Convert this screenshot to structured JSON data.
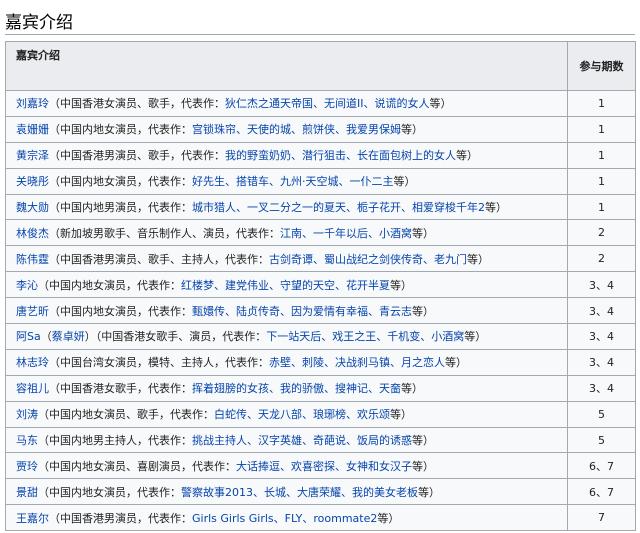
{
  "section": {
    "title": "嘉宾介绍"
  },
  "table": {
    "headers": {
      "guest": "嘉宾介绍",
      "episodes": "参与期数"
    },
    "rows": [
      {
        "name": "刘嘉玲",
        "desc": "（中国香港女演员、歌手，代表作：",
        "works": "狄仁杰之通天帝国、无间道II、说谎的女人",
        "tail": "等）",
        "episodes": "1"
      },
      {
        "name": "袁姗姗",
        "desc": "（中国内地女演员，代表作：",
        "works": "宫锁珠帘、天使的城、煎饼侠、我爱男保姆",
        "tail": "等）",
        "episodes": "1"
      },
      {
        "name": "黄宗泽",
        "desc": "（中国香港男演员、歌手，代表作：",
        "works": "我的野蛮奶奶、潜行狙击、长在面包树上的女人",
        "tail": "等）",
        "episodes": "1"
      },
      {
        "name": "关晓彤",
        "desc": "（中国内地女演员，代表作：",
        "works": "好先生、搭错车、九州·天空城、一仆二主",
        "tail": "等）",
        "episodes": "1"
      },
      {
        "name": "魏大勋",
        "desc": "（中国内地男演员，代表作：",
        "works": "城市猎人、一叉二分之一的夏天、栀子花开、相爱穿梭千年2",
        "tail": "等）",
        "episodes": "1"
      },
      {
        "name": "林俊杰",
        "desc": "（新加坡男歌手、音乐制作人、演员，代表作：",
        "works": "江南、一千年以后、小酒窝",
        "tail": "等）",
        "episodes": "2"
      },
      {
        "name": "陈伟霆",
        "desc": "（中国香港男演员、歌手、主持人，代表作：",
        "works": "古剑奇谭、蜀山战纪之剑侠传奇、老九门",
        "tail": "等）",
        "episodes": "2"
      },
      {
        "name": "李沁",
        "desc": "（中国内地女演员，代表作：",
        "works": "红楼梦、建党伟业、守望的天空、花开半夏",
        "tail": "等）",
        "episodes": "3、4"
      },
      {
        "name": "唐艺昕",
        "desc": "（中国内地女演员，代表作：",
        "works": "甄嬛传、陆贞传奇、因为爱情有幸福、青云志",
        "tail": "等）",
        "episodes": "3、4"
      },
      {
        "name": "阿Sa",
        "alias": "蔡卓妍",
        "desc": "（中国香港女歌手、演员，代表作：",
        "works": "下一站天后、戏王之王、千机变、小酒窝",
        "tail": "等）",
        "episodes": "3、4"
      },
      {
        "name": "林志玲",
        "desc": "（中国台湾女演员，模特、主持人，代表作：",
        "works": "赤壁、刺陵、决战刹马镇、月之恋人",
        "tail": "等）",
        "episodes": "3、4"
      },
      {
        "name": "容祖儿",
        "desc": "（中国香港女歌手，代表作：",
        "works": "挥着翅膀的女孩、我的骄傲、搜神记、天奤",
        "tail": "等）",
        "episodes": "3、4"
      },
      {
        "name": "刘涛",
        "desc": "（中国内地女演员、歌手，代表作：",
        "works": "白蛇传、天龙八部、琅琊榜、欢乐颂",
        "tail": "等）",
        "episodes": "5"
      },
      {
        "name": "马东",
        "desc": "（中国内地男主持人，代表作：",
        "works": "挑战主持人、汉字英雄、奇葩说、饭局的诱惑",
        "tail": "等）",
        "episodes": "5"
      },
      {
        "name": "贾玲",
        "desc": "（中国内地女演员、喜剧演员，代表作：",
        "works": "大话捧逗、欢喜密探、女神和女汉子",
        "tail": "等）",
        "episodes": "6、7"
      },
      {
        "name": "景甜",
        "desc": "（中国内地女演员，代表作：",
        "works": "警察故事2013、长城、大唐荣耀、我的美女老板",
        "tail": "等）",
        "episodes": "6、7"
      },
      {
        "name": "王嘉尔",
        "desc": "（中国香港男演员，代表作：",
        "works": "Girls Girls Girls、FLY、roommate2",
        "tail": "等）",
        "episodes": "7"
      }
    ]
  }
}
